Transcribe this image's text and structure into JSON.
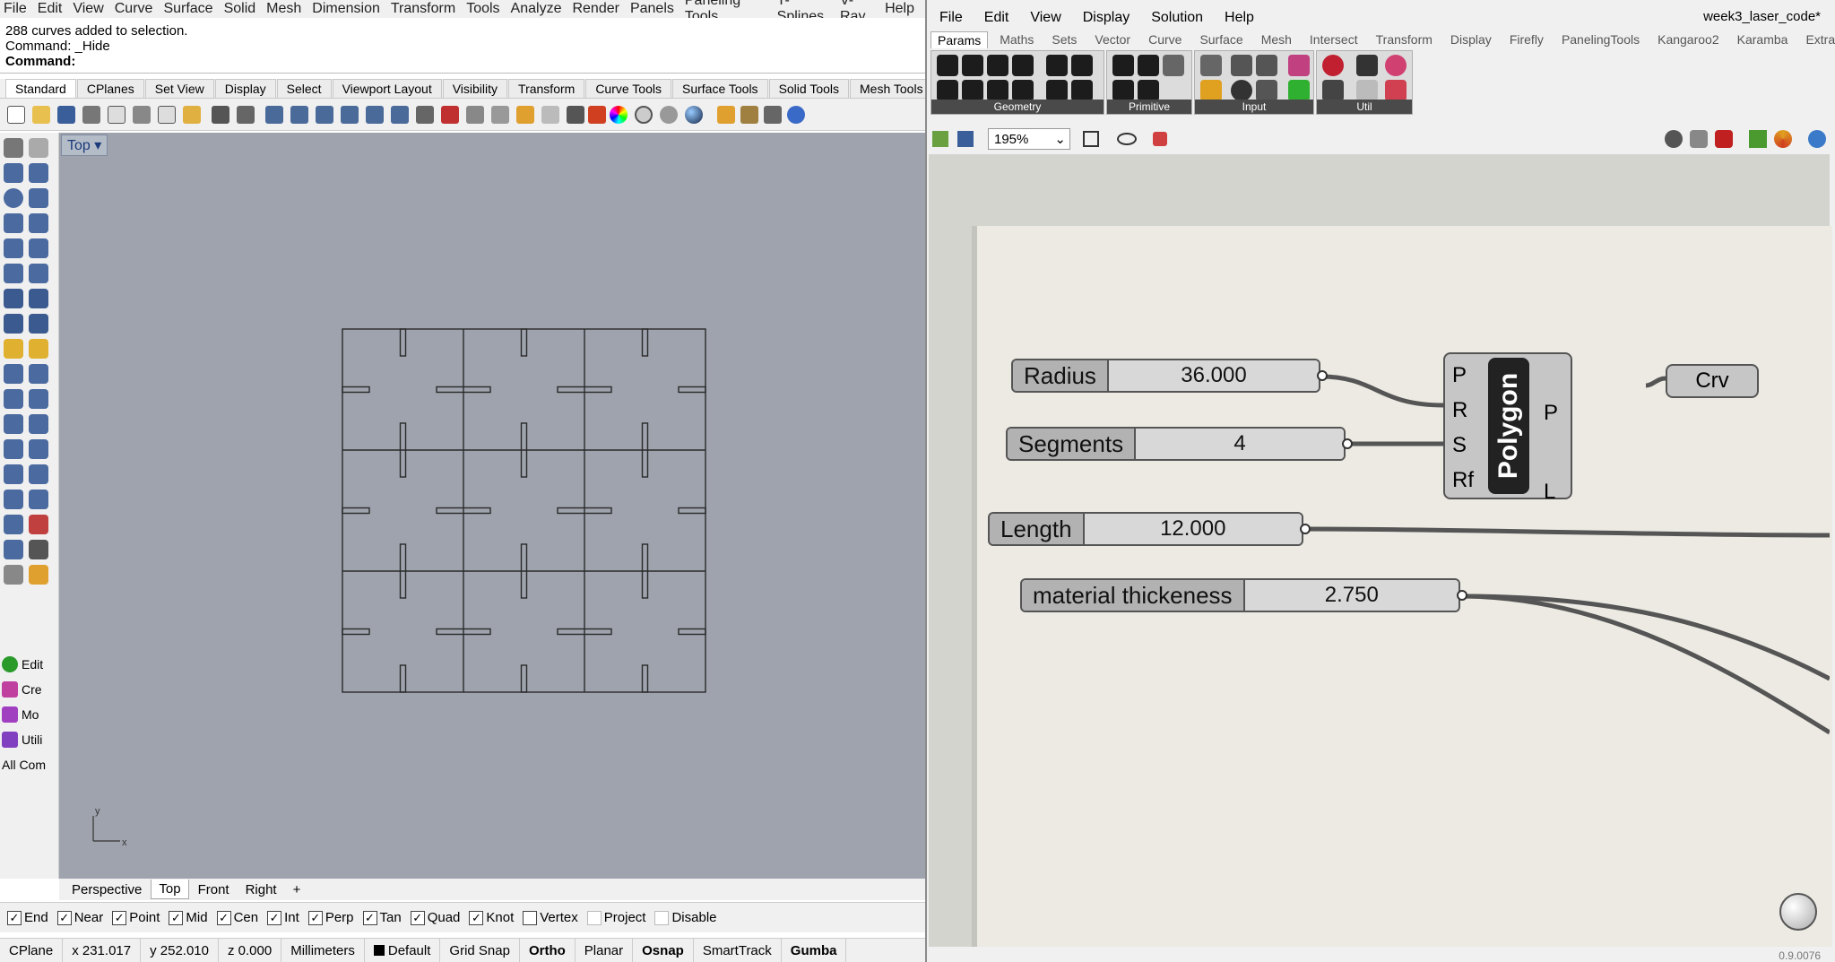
{
  "rhino": {
    "menu": [
      "File",
      "Edit",
      "View",
      "Curve",
      "Surface",
      "Solid",
      "Mesh",
      "Dimension",
      "Transform",
      "Tools",
      "Analyze",
      "Render",
      "Panels",
      "Paneling Tools",
      "T-Splines",
      "V-Ray",
      "Help"
    ],
    "command_history": [
      "288 curves added to selection.",
      "Command: _Hide"
    ],
    "command_prompt": "Command:",
    "toolbar_tabs": [
      "Standard",
      "CPlanes",
      "Set View",
      "Display",
      "Select",
      "Viewport Layout",
      "Visibility",
      "Transform",
      "Curve Tools",
      "Surface Tools",
      "Solid Tools",
      "Mesh Tools"
    ],
    "side_panels": [
      "Edit",
      "Cre",
      "Mo",
      "Utili",
      "All Com"
    ],
    "viewport_label": "Top",
    "viewport_tabs": [
      "Perspective",
      "Top",
      "Front",
      "Right",
      "+"
    ],
    "osnaps": [
      {
        "label": "End",
        "checked": true
      },
      {
        "label": "Near",
        "checked": true
      },
      {
        "label": "Point",
        "checked": true
      },
      {
        "label": "Mid",
        "checked": true
      },
      {
        "label": "Cen",
        "checked": true
      },
      {
        "label": "Int",
        "checked": true
      },
      {
        "label": "Perp",
        "checked": true
      },
      {
        "label": "Tan",
        "checked": true
      },
      {
        "label": "Quad",
        "checked": true
      },
      {
        "label": "Knot",
        "checked": true
      },
      {
        "label": "Vertex",
        "checked": false
      },
      {
        "label": "Project",
        "checked": false
      },
      {
        "label": "Disable",
        "checked": false
      }
    ],
    "status": {
      "cplane": "CPlane",
      "x": "x 231.017",
      "y": "y 252.010",
      "z": "z 0.000",
      "units": "Millimeters",
      "layer": "Default",
      "grid_snap": "Grid Snap",
      "ortho": "Ortho",
      "planar": "Planar",
      "osnap": "Osnap",
      "smarttrack": "SmartTrack",
      "gumball": "Gumba"
    }
  },
  "grasshopper": {
    "menu": [
      "File",
      "Edit",
      "View",
      "Display",
      "Solution",
      "Help"
    ],
    "doc_title": "week3_laser_code*",
    "tabs": [
      "Params",
      "Maths",
      "Sets",
      "Vector",
      "Curve",
      "Surface",
      "Mesh",
      "Intersect",
      "Transform",
      "Display",
      "Firefly",
      "PanelingTools",
      "Kangaroo2",
      "Karamba",
      "Extra"
    ],
    "groups": [
      "Geometry",
      "Primitive",
      "Input",
      "Util"
    ],
    "zoom": "195%",
    "sliders": {
      "radius": {
        "name": "Radius",
        "value": "36.000"
      },
      "segments": {
        "name": "Segments",
        "value": "4"
      },
      "length": {
        "name": "Length",
        "value": "12.000"
      },
      "thickness": {
        "name": "material thickeness",
        "value": "2.750"
      }
    },
    "polygon": {
      "title": "Polygon",
      "inputs": [
        "P",
        "R",
        "S",
        "Rf"
      ],
      "outputs": [
        "P",
        "L"
      ]
    },
    "crv": "Crv",
    "version": "0.9.0076"
  }
}
